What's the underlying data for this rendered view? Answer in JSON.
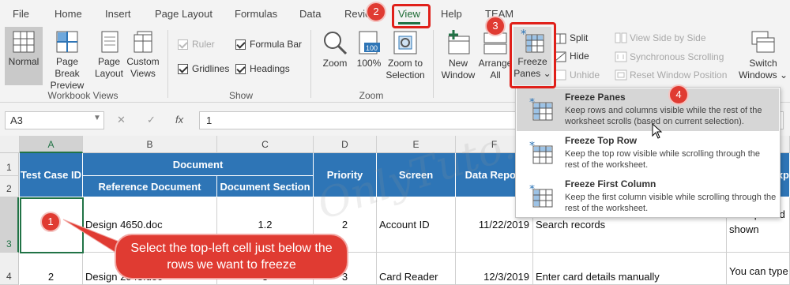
{
  "tabs": [
    "File",
    "Home",
    "Insert",
    "Page Layout",
    "Formulas",
    "Data",
    "Revie",
    "View",
    "Help",
    "TEAM"
  ],
  "ribbon": {
    "workbook_views": {
      "normal": "Normal",
      "page_break_1": "Page Break",
      "page_break_2": "Preview",
      "page_layout_1": "Page",
      "page_layout_2": "Layout",
      "custom_1": "Custom",
      "custom_2": "Views",
      "group": "Workbook Views"
    },
    "show": {
      "ruler": "Ruler",
      "formula_bar": "Formula Bar",
      "gridlines": "Gridlines",
      "headings": "Headings",
      "group": "Show"
    },
    "zoom": {
      "zoom": "Zoom",
      "hundred": "100%",
      "icon_text": "100",
      "to_sel_1": "Zoom to",
      "to_sel_2": "Selection",
      "group": "Zoom"
    },
    "window": {
      "new_1": "New",
      "new_2": "Window",
      "arrange_1": "Arrange",
      "arrange_2": "All",
      "freeze_1": "Freeze",
      "freeze_2": "Panes",
      "freeze_caret": "⌄",
      "split": "Split",
      "hide": "Hide",
      "unhide": "Unhide",
      "side_by_side": "View Side by Side",
      "sync_scroll": "Synchronous Scrolling",
      "reset_pos": "Reset Window Position",
      "switch_1": "Switch",
      "switch_2": "Windows",
      "switch_caret": "⌄"
    }
  },
  "formula_bar": {
    "name_box": "A3",
    "cancel_symbol": "✕",
    "enter_symbol": "✓",
    "fx_symbol": "fx",
    "value": "1"
  },
  "grid": {
    "columns": [
      "A",
      "B",
      "C",
      "D",
      "E",
      "F"
    ],
    "rows": [
      "1",
      "2",
      "3",
      "4"
    ],
    "headers": {
      "test_case_id": "Test Case ID",
      "document": "Document",
      "ref_doc": "Reference Document",
      "doc_section": "Document Section",
      "priority": "Priority",
      "screen": "Screen",
      "data_report": "Data Report",
      "cut_h": "Exp"
    },
    "row3": {
      "test_case": "1",
      "ref_doc": "Design 4650.doc",
      "section": "1.2",
      "priority": "2",
      "screen": "Account ID",
      "date": "11/22/2019",
      "step": "Search records",
      "expected": "All expected shown"
    },
    "row4": {
      "test_case": "2",
      "ref_doc": "Design 2043.doc",
      "section": "3",
      "priority": "3",
      "screen": "Card Reader",
      "date": "12/3/2019",
      "step": "Enter card details manually",
      "expected": "You can type"
    }
  },
  "freeze_menu": [
    {
      "title": "Freeze Panes",
      "desc": "Keep rows and columns visible while the rest of the worksheet scrolls (based on current selection)."
    },
    {
      "title": "Freeze Top Row",
      "desc": "Keep the top row visible while scrolling through the rest of the worksheet."
    },
    {
      "title": "Freeze First Column",
      "desc": "Keep the first column visible while scrolling through the rest of the worksheet."
    }
  ],
  "annotations": {
    "steps": [
      "1",
      "2",
      "3",
      "4"
    ],
    "callout": "Select the top-left cell just below the rows we want to freeze",
    "watermark": "OnlyTuto.com",
    "color": "#e03b32"
  },
  "colors": {
    "excel_green": "#217346",
    "header_blue": "#2e75b6",
    "ribbon_bg": "#f3f3f3"
  }
}
